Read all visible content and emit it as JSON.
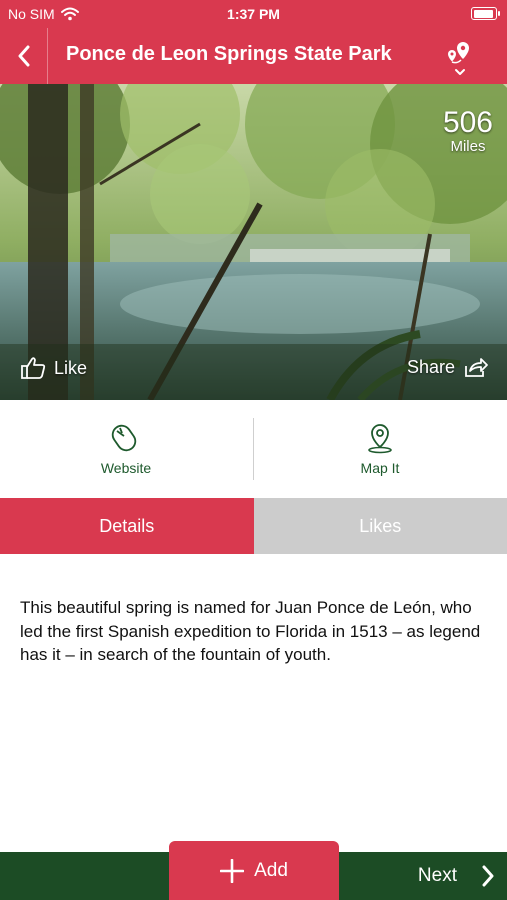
{
  "status_bar": {
    "carrier": "No SIM",
    "time": "1:37 PM"
  },
  "nav": {
    "title": "Ponce de Leon Springs State Park"
  },
  "hero": {
    "distance_value": "506",
    "distance_unit": "Miles",
    "like_label": "Like",
    "share_label": "Share"
  },
  "actions": {
    "website_label": "Website",
    "map_label": "Map It"
  },
  "tabs": [
    {
      "label": "Details",
      "active": true
    },
    {
      "label": "Likes",
      "active": false
    }
  ],
  "details": {
    "text": "This beautiful spring is named for Juan Ponce de León, who led the first Spanish expedition to Florida in 1513 – as legend has it – in search of the fountain of youth."
  },
  "footer": {
    "add_label": "Add",
    "next_label": "Next"
  },
  "colors": {
    "brand_red": "#d9394f",
    "footer_green": "#1c4c25",
    "icon_green": "#1e5a2d",
    "tab_inactive": "#cccccc"
  }
}
